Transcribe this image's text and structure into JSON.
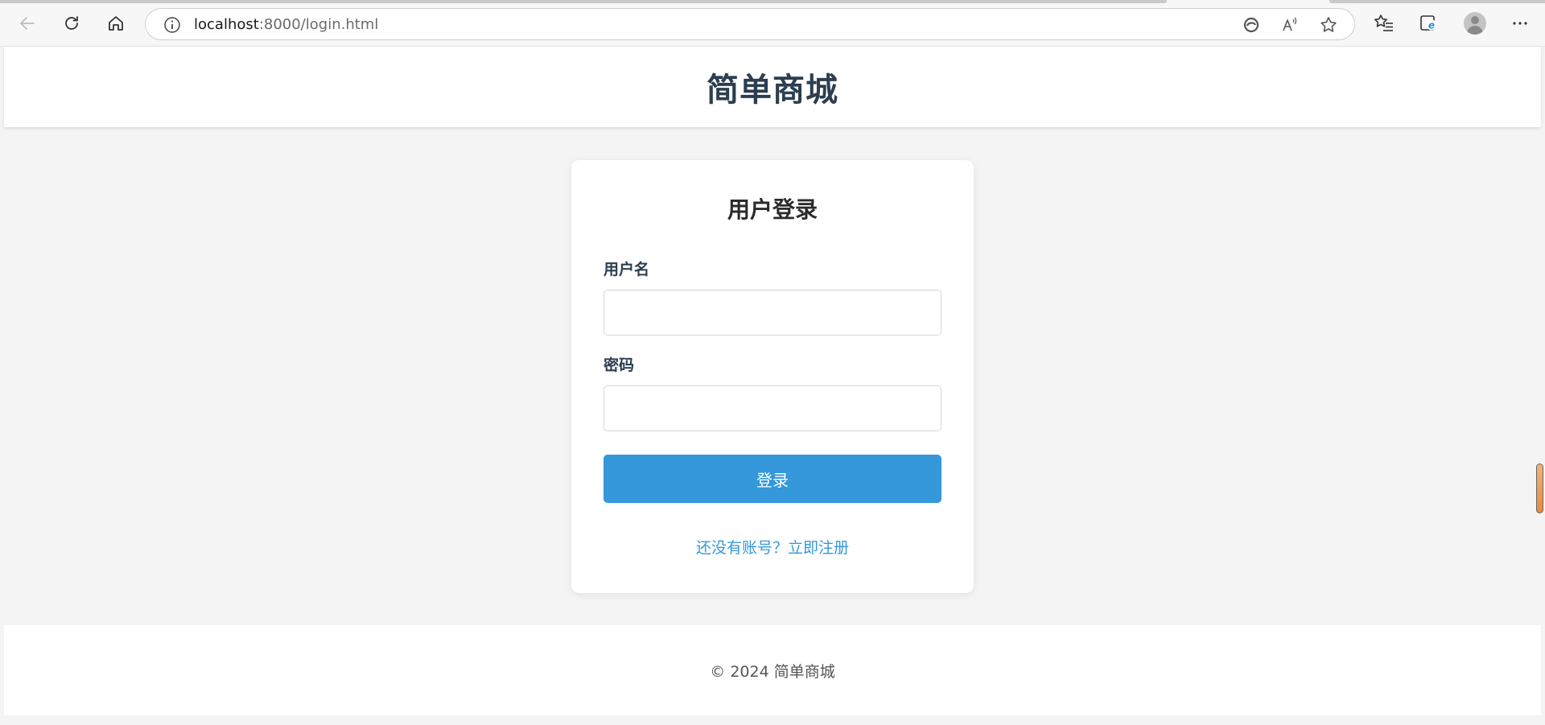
{
  "browser": {
    "url_host": "localhost",
    "url_path": ":8000/login.html",
    "icons": [
      "back-arrow-icon",
      "refresh-icon",
      "home-icon",
      "info-icon",
      "edge-refresh-icon",
      "read-aloud-icon",
      "favorite-star-icon",
      "favorites-list-icon",
      "ie-mode-icon",
      "profile-avatar",
      "more-menu-icon"
    ]
  },
  "header": {
    "site_title": "简单商城"
  },
  "login": {
    "title": "用户登录",
    "username_label": "用户名",
    "username_value": "",
    "password_label": "密码",
    "password_value": "",
    "submit_label": "登录",
    "register_link": "还没有账号？立即注册"
  },
  "footer": {
    "text": "© 2024 简单商城"
  },
  "colors": {
    "accent": "#3498db",
    "title": "#2c3e50",
    "background": "#f4f4f4"
  }
}
